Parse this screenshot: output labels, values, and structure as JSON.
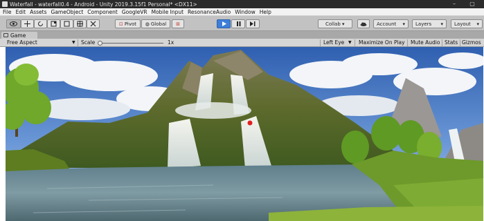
{
  "window": {
    "title": "Waterfall - waterfall0.4 - Android - Unity 2019.3.15f1 Personal* <DX11>",
    "controls": [
      "–",
      "▢"
    ]
  },
  "menu": [
    "File",
    "Edit",
    "Assets",
    "GameObject",
    "Component",
    "GoogleVR",
    "Mobile Input",
    "ResonanceAudio",
    "Window",
    "Help"
  ],
  "toolbar": {
    "pivot_label": "Pivot",
    "global_label": "Global",
    "collab_label": "Collab ▾",
    "account_label": "Account",
    "layers_label": "Layers",
    "layout_label": "Layout",
    "accent_color": "#3d7ed8"
  },
  "game_tab": {
    "label": "Game"
  },
  "game_view": {
    "aspect_label": "Free Aspect",
    "scale_label": "Scale",
    "scale_value": "1x",
    "scale_fraction": 0.0,
    "eye_label": "Left Eye",
    "maximize_label": "Maximize On Play",
    "mute_label": "Mute Audio",
    "stats_label": "Stats",
    "gizmos_label": "Gizmos"
  },
  "scene": {
    "description_icons": [
      "waterfall",
      "mountain",
      "lake",
      "trees",
      "sky"
    ]
  }
}
